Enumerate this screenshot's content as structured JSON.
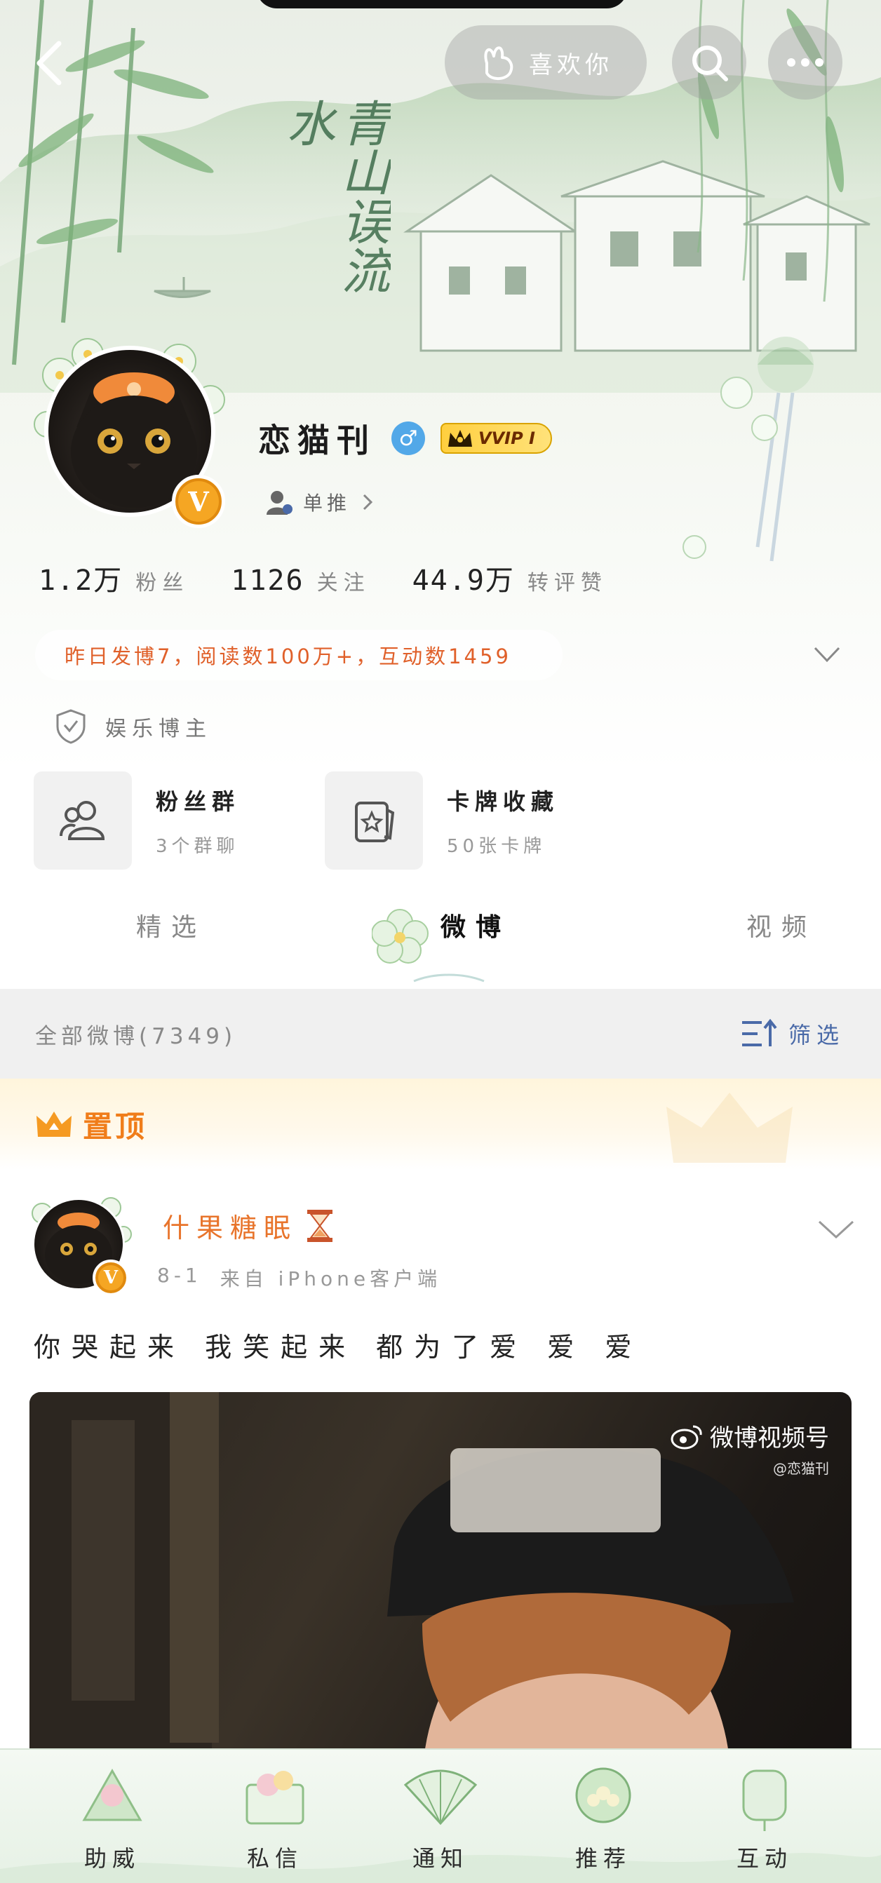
{
  "header": {
    "like_label": "喜欢你",
    "calligraphy": "青山误流水"
  },
  "profile": {
    "name": "恋猫刊",
    "vip_label": "VVIP I",
    "fan_push_label": "单推"
  },
  "stats": [
    {
      "value": "1.2万",
      "label": "粉丝"
    },
    {
      "value": "1126",
      "label": "关注"
    },
    {
      "value": "44.9万",
      "label": "转评赞"
    }
  ],
  "summary": "昨日发博7，阅读数100万+，互动数1459",
  "role": "娱乐博主",
  "cards": [
    {
      "title": "粉丝群",
      "sub": "3个群聊"
    },
    {
      "title": "卡牌收藏",
      "sub": "50张卡牌"
    }
  ],
  "tabs": [
    "精选",
    "微博",
    "视频"
  ],
  "filter": {
    "count_label": "全部微博(7349)",
    "button_label": "筛选"
  },
  "pinned": {
    "label": "置顶"
  },
  "post": {
    "author": "什果糖眠",
    "date": "8-1",
    "source": "来自 iPhone客户端",
    "text": "你哭起来 我笑起来 都为了爱 爱 爱",
    "watermark_main": "微博视频号",
    "watermark_sub": "@恋猫刊"
  },
  "bottom_nav": [
    "助威",
    "私信",
    "通知",
    "推荐",
    "互动"
  ],
  "colors": {
    "accent_orange": "#e8742b",
    "link_blue": "#4a6aa8",
    "verified_gold": "#f5a623"
  }
}
